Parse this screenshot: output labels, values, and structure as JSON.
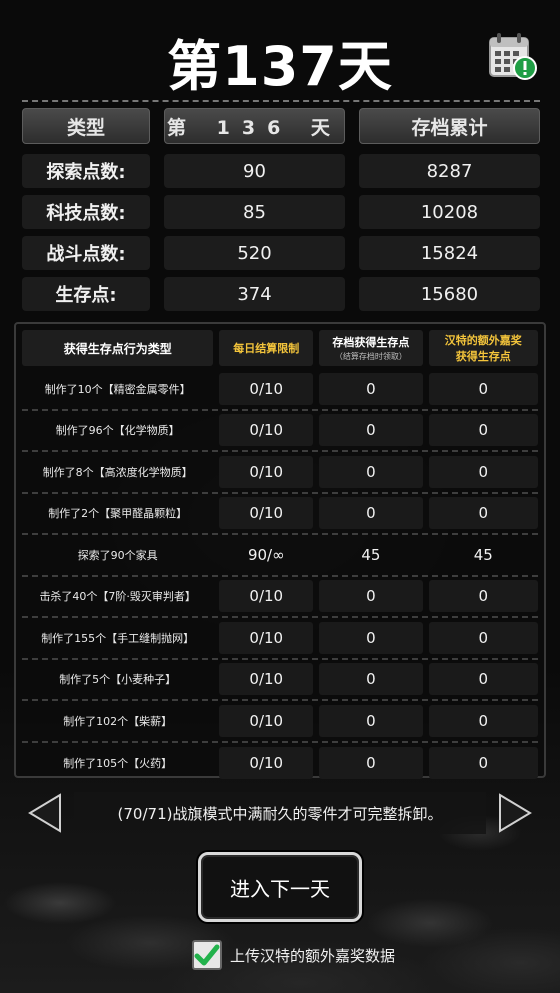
{
  "header": {
    "title": "第137天"
  },
  "summary": {
    "headers": [
      "类型",
      "第  136  天",
      "存档累计"
    ],
    "rows": [
      {
        "label": "探索点数:",
        "day": "90",
        "total": "8287"
      },
      {
        "label": "科技点数:",
        "day": "85",
        "total": "10208"
      },
      {
        "label": "战斗点数:",
        "day": "520",
        "total": "15824"
      },
      {
        "label": "生存点:",
        "day": "374",
        "total": "15680"
      }
    ]
  },
  "detail": {
    "headers": {
      "type": "获得生存点行为类型",
      "daily_limit": "每日结算限制",
      "archive": "存档获得生存点",
      "archive_sub": "（结算存档时领取）",
      "hunter": "汉特的额外嘉奖",
      "hunter_line2": "获得生存点"
    },
    "rows": [
      {
        "action": "制作了10个【精密金属零件】",
        "limit": "0/10",
        "archive": "0",
        "hunter": "0"
      },
      {
        "action": "制作了96个【化学物质】",
        "limit": "0/10",
        "archive": "0",
        "hunter": "0"
      },
      {
        "action": "制作了8个【高浓度化学物质】",
        "limit": "0/10",
        "archive": "0",
        "hunter": "0"
      },
      {
        "action": "制作了2个【聚甲醛晶颗粒】",
        "limit": "0/10",
        "archive": "0",
        "hunter": "0"
      },
      {
        "action": "探索了90个家具",
        "limit": "90/∞",
        "archive": "45",
        "hunter": "45"
      },
      {
        "action": "击杀了40个【7阶·毁灭审判者】",
        "limit": "0/10",
        "archive": "0",
        "hunter": "0"
      },
      {
        "action": "制作了155个【手工缝制抛网】",
        "limit": "0/10",
        "archive": "0",
        "hunter": "0"
      },
      {
        "action": "制作了5个【小麦种子】",
        "limit": "0/10",
        "archive": "0",
        "hunter": "0"
      },
      {
        "action": "制作了102个【柴薪】",
        "limit": "0/10",
        "archive": "0",
        "hunter": "0"
      },
      {
        "action": "制作了105个【火药】",
        "limit": "0/10",
        "archive": "0",
        "hunter": "0"
      }
    ]
  },
  "tip": {
    "text": "(70/71)战旗模式中满耐久的零件才可完整拆卸。"
  },
  "buttons": {
    "next_day": "进入下一天"
  },
  "upload": {
    "label": "上传汉特的额外嘉奖数据",
    "checked": true
  },
  "icons": {
    "calendar": "calendar-alert-icon",
    "prev": "arrow-left-icon",
    "next": "arrow-right-icon",
    "check": "checkmark-icon"
  },
  "colors": {
    "accent_gold": "#f3c43b",
    "check_green": "#22b24c",
    "alert_green": "#1f9e45"
  }
}
